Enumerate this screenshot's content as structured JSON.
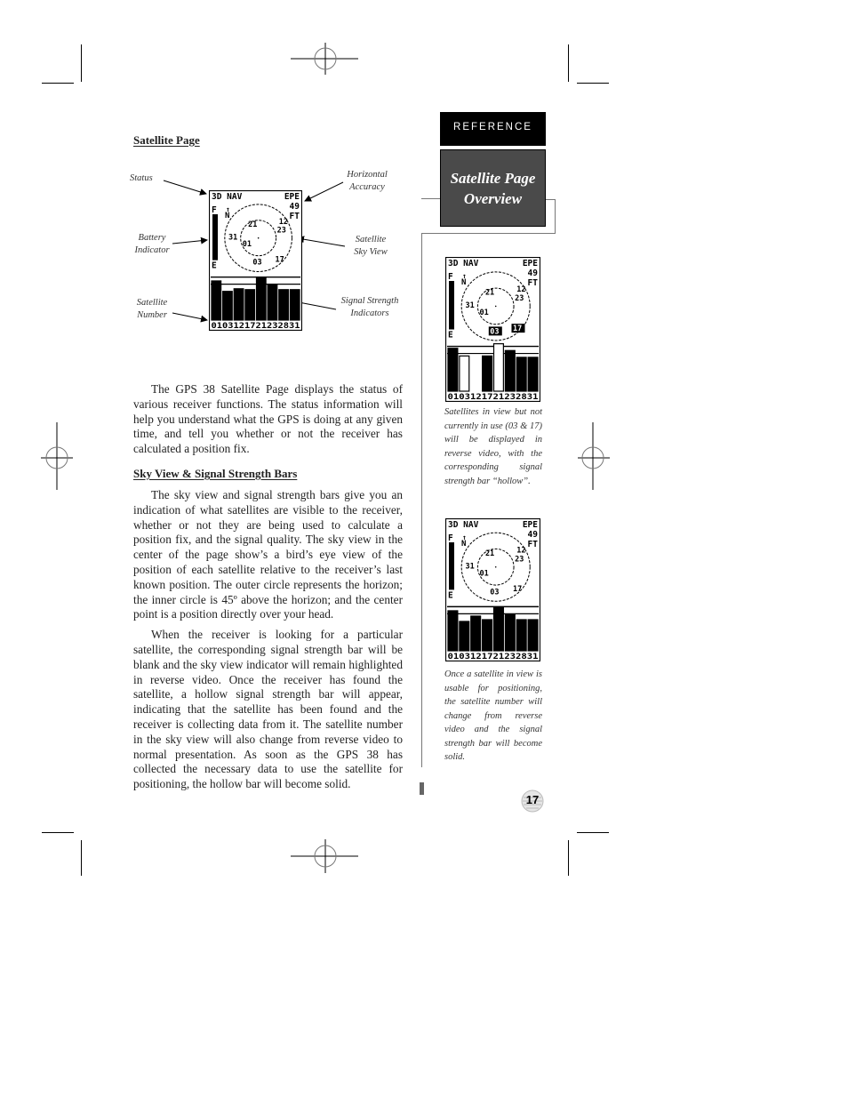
{
  "section_tab": "REFERENCE",
  "section_title": [
    "Satellite Page",
    "Overview"
  ],
  "headings": {
    "satellite_page": "Satellite Page",
    "sky_view": "Sky View & Signal Strength Bars"
  },
  "diagram": {
    "callouts": {
      "status": "Status",
      "horizontal_accuracy": [
        "Horizontal",
        "Accuracy"
      ],
      "battery_indicator": [
        "Battery",
        "Indicator"
      ],
      "satellite_sky_view": [
        "Satellite",
        "Sky View"
      ],
      "satellite_number": [
        "Satellite",
        "Number"
      ],
      "signal_strength_indicators": [
        "Signal Strength",
        "Indicators"
      ]
    }
  },
  "gps_screen": {
    "status": "3D NAV",
    "epe_label": "EPE",
    "epe_value": "49",
    "epe_unit": "FT",
    "battery_full": "F",
    "battery_empty": "E",
    "north": "N",
    "satellites": [
      "01",
      "03",
      "12",
      "17",
      "21",
      "23",
      "28",
      "31"
    ],
    "satellite_row": "0103121721232831",
    "sky_labels": {
      "s21": "21",
      "s12": "12",
      "s23": "23",
      "s31": "31",
      "s01": "01",
      "s17": "17",
      "s03": "03"
    }
  },
  "paragraphs": {
    "intro": "The GPS 38 Satellite Page displays the status of various receiver functions. The status information will help you understand what the GPS is doing at any given time, and tell you whether or not the receiver has calculated a position fix.",
    "sky1": "The sky view and signal strength bars give you an indication of what satellites are visible to the receiver, whether or not they are being used to calculate a position fix, and the signal quality. The sky view in the center of the page show’s a bird’s eye view of the position of each satellite relative to the receiver’s last known position. The outer circle represents the horizon; the inner circle is 45º above the horizon; and the center point is a position directly over your head.",
    "sky2": "When the receiver is looking for a particular satellite, the corresponding signal strength bar will be blank and the sky view indicator will remain highlighted in reverse video. Once the receiver has found the satellite, a hollow signal strength bar will appear, indicating that the satellite has been found and the receiver is collecting data from it. The satellite number in the sky view will also change from reverse video to normal presentation. As soon as the GPS 38 has collected the necessary data to use the satellite for positioning, the hollow bar will become solid."
  },
  "captions": {
    "first": "Satellites in view but not currently in use (03 & 17) will be displayed in reverse video, with the corresponding signal strength bar “hollow”.",
    "second": "Once a satellite in view is usable for positioning, the satellite number will change from reverse video and the signal strength bar will become solid."
  },
  "page_number": "17"
}
